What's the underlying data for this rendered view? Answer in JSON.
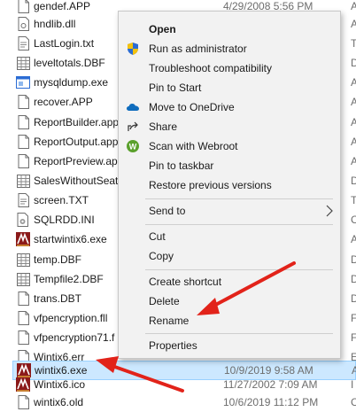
{
  "files": [
    {
      "name": "gendef.APP",
      "date": "4/29/2008 5:56 PM",
      "type": "A",
      "icon": "app-file-icon"
    },
    {
      "name": "hndlib.dll",
      "date": "",
      "type": "A",
      "icon": "dll-file-icon"
    },
    {
      "name": "LastLogin.txt",
      "date": "",
      "type": "T",
      "icon": "text-file-icon"
    },
    {
      "name": "leveltotals.DBF",
      "date": "",
      "type": "D",
      "icon": "dbf-file-icon"
    },
    {
      "name": "mysqldump.exe",
      "date": "",
      "type": "A",
      "icon": "exe-file-icon"
    },
    {
      "name": "recover.APP",
      "date": "",
      "type": "A",
      "icon": "app-file-icon"
    },
    {
      "name": "ReportBuilder.app",
      "date": "",
      "type": "A",
      "icon": "app-file-icon"
    },
    {
      "name": "ReportOutput.app",
      "date": "",
      "type": "A",
      "icon": "app-file-icon"
    },
    {
      "name": "ReportPreview.ap",
      "date": "",
      "type": "A",
      "icon": "app-file-icon"
    },
    {
      "name": "SalesWithoutSeats",
      "date": "",
      "type": "D",
      "icon": "dbf-file-icon"
    },
    {
      "name": "screen.TXT",
      "date": "",
      "type": "T",
      "icon": "text-file-icon"
    },
    {
      "name": "SQLRDD.INI",
      "date": "",
      "type": "C",
      "icon": "ini-file-icon"
    },
    {
      "name": "startwintix6.exe",
      "date": "",
      "type": "A",
      "icon": "wintix-exe-icon"
    },
    {
      "name": "temp.DBF",
      "date": "",
      "type": "D",
      "icon": "dbf-file-icon"
    },
    {
      "name": "Tempfile2.DBF",
      "date": "",
      "type": "D",
      "icon": "dbf-file-icon"
    },
    {
      "name": "trans.DBT",
      "date": "",
      "type": "D",
      "icon": "app-file-icon"
    },
    {
      "name": "vfpencryption.fll",
      "date": "",
      "type": "F",
      "icon": "app-file-icon"
    },
    {
      "name": "vfpencryption71.f",
      "date": "",
      "type": "F",
      "icon": "app-file-icon"
    },
    {
      "name": "Wintix6.err",
      "date": "",
      "type": "E",
      "icon": "app-file-icon"
    },
    {
      "name": "wintix6.exe",
      "date": "10/9/2019 9:58 AM",
      "type": "A",
      "icon": "wintix-exe-icon",
      "selected": true
    },
    {
      "name": "Wintix6.ico",
      "date": "11/27/2002 7:09 AM",
      "type": "I",
      "icon": "wintix-exe-icon"
    },
    {
      "name": "wintix6.old",
      "date": "10/6/2019 11:12 PM",
      "type": "C",
      "icon": "app-file-icon"
    }
  ],
  "menu": {
    "open": "Open",
    "run_as_admin": "Run as administrator",
    "troubleshoot": "Troubleshoot compatibility",
    "pin_start": "Pin to Start",
    "move_onedrive": "Move to OneDrive",
    "share": "Share",
    "scan_webroot": "Scan with Webroot",
    "pin_taskbar": "Pin to taskbar",
    "restore_versions": "Restore previous versions",
    "send_to": "Send to",
    "cut": "Cut",
    "copy": "Copy",
    "create_shortcut": "Create shortcut",
    "delete": "Delete",
    "rename": "Rename",
    "properties": "Properties",
    "webroot_badge": "W"
  },
  "colors": {
    "selection": "#cce8ff",
    "menu_bg": "#f2f2f2",
    "arrow": "#e2231a",
    "shield_blue": "#2b6cd4",
    "shield_yellow": "#f4c20d",
    "onedrive_blue": "#0f6cbd",
    "webroot_green": "#5aa02c"
  }
}
